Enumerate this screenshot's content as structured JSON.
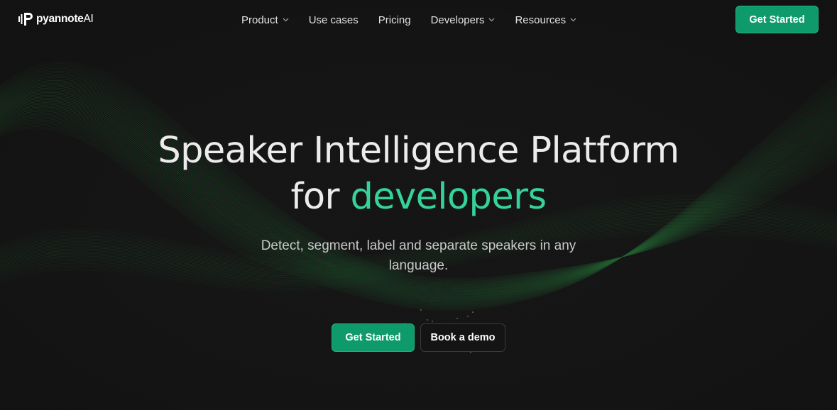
{
  "brand": {
    "name_bold": "pyannote",
    "name_light": "AI",
    "logo_icon": "pyannote-logo-icon"
  },
  "nav": {
    "items": [
      {
        "label": "Product",
        "has_dropdown": true
      },
      {
        "label": "Use cases",
        "has_dropdown": false
      },
      {
        "label": "Pricing",
        "has_dropdown": false
      },
      {
        "label": "Developers",
        "has_dropdown": true
      },
      {
        "label": "Resources",
        "has_dropdown": true
      }
    ],
    "cta_label": "Get Started"
  },
  "hero": {
    "title_line1": "Speaker Intelligence Platform",
    "title_line2_prefix": "for ",
    "title_line2_accent": "developers",
    "subtitle": "Detect, segment, label and separate speakers in any language."
  },
  "cta": {
    "primary_label": "Get Started",
    "secondary_label": "Book a demo"
  },
  "colors": {
    "background": "#151515",
    "accent_text": "#35d39a",
    "button_green": "#0f9a6c",
    "wave_green": "#1f7a3c"
  }
}
